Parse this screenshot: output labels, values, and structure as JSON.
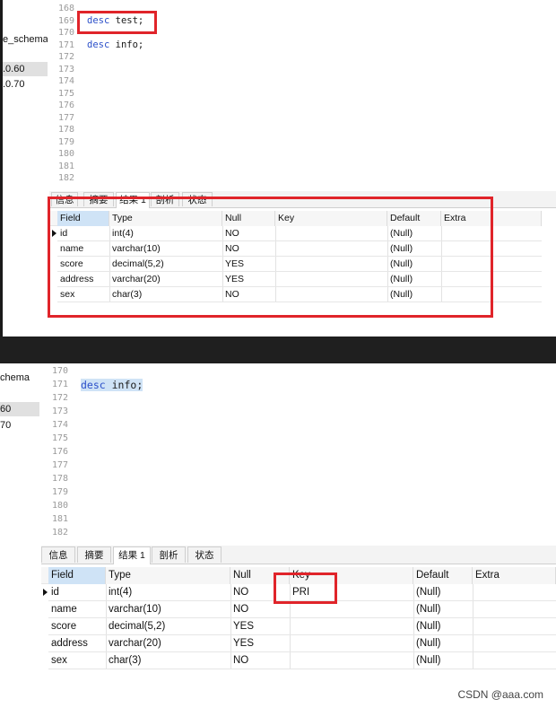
{
  "top": {
    "sidebar": [
      "e_schema",
      ".0.60",
      ".0.70"
    ],
    "line_numbers": [
      "168",
      "169",
      "170",
      "171",
      "172",
      "173",
      "174",
      "175",
      "176",
      "177",
      "178",
      "179",
      "180",
      "181",
      "182"
    ],
    "code": {
      "line169_kw": "desc",
      "line169_id": " test;",
      "line171_kw": "desc",
      "line171_id": " info;"
    },
    "tabs": [
      "信息",
      "摘要",
      "结果 1",
      "剖析",
      "状态"
    ],
    "headers": [
      "Field",
      "Type",
      "Null",
      "Key",
      "Default",
      "Extra"
    ],
    "rows": [
      {
        "field": "id",
        "type": "int(4)",
        "null": "NO",
        "key": "",
        "default": "(Null)",
        "extra": ""
      },
      {
        "field": "name",
        "type": "varchar(10)",
        "null": "NO",
        "key": "",
        "default": "(Null)",
        "extra": ""
      },
      {
        "field": "score",
        "type": "decimal(5,2)",
        "null": "YES",
        "key": "",
        "default": "(Null)",
        "extra": ""
      },
      {
        "field": "address",
        "type": "varchar(20)",
        "null": "YES",
        "key": "",
        "default": "(Null)",
        "extra": ""
      },
      {
        "field": "sex",
        "type": "char(3)",
        "null": "NO",
        "key": "",
        "default": "(Null)",
        "extra": ""
      }
    ]
  },
  "bottom": {
    "sidebar": [
      "chema",
      "60",
      "70"
    ],
    "line_numbers": [
      "170",
      "171",
      "172",
      "173",
      "174",
      "175",
      "176",
      "177",
      "178",
      "179",
      "180",
      "181",
      "182"
    ],
    "code": {
      "line171_kw": "desc",
      "line171_id": " info;"
    },
    "tabs": [
      "信息",
      "摘要",
      "结果 1",
      "剖析",
      "状态"
    ],
    "headers": [
      "Field",
      "Type",
      "Null",
      "Key",
      "Default",
      "Extra"
    ],
    "rows": [
      {
        "field": "id",
        "type": "int(4)",
        "null": "NO",
        "key": "PRI",
        "default": "(Null)",
        "extra": ""
      },
      {
        "field": "name",
        "type": "varchar(10)",
        "null": "NO",
        "key": "",
        "default": "(Null)",
        "extra": ""
      },
      {
        "field": "score",
        "type": "decimal(5,2)",
        "null": "YES",
        "key": "",
        "default": "(Null)",
        "extra": ""
      },
      {
        "field": "address",
        "type": "varchar(20)",
        "null": "YES",
        "key": "",
        "default": "(Null)",
        "extra": ""
      },
      {
        "field": "sex",
        "type": "char(3)",
        "null": "NO",
        "key": "",
        "default": "(Null)",
        "extra": ""
      }
    ]
  },
  "watermark": "CSDN @aaa.com"
}
